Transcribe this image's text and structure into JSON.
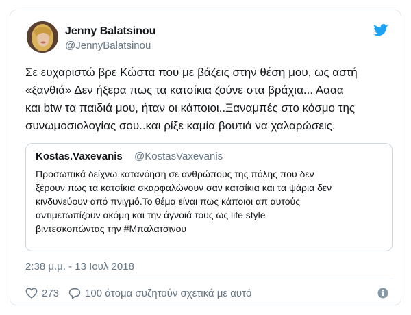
{
  "author": {
    "name": "Jenny Balatsinou",
    "handle": "@JennyBalatsinou",
    "avatar_icon": "profile-photo"
  },
  "tweet": {
    "lines": [
      "Σε ευχαριστώ βρε Κώστα που με βάζεις στην θέση μου, ως αστή",
      "«ξανθιά» Δεν ήξερα πως τα κατσίκια ζούνε στα βράχια... Αααα",
      "και btw τα παιδιά μου, ήταν οι κάποιοι..Ξαναμπές  στο κόσμο της",
      "συνωμοσιολογίας σου..και ρίξε καμία βουτιά να χαλαρώσεις."
    ]
  },
  "quoted": {
    "name": "Kostas.Vaxevanis",
    "handle": "@KostasVaxevanis",
    "lines": [
      "Προσωπικά δείχνω κατανόηση σε ανθρώπους της πόλης που δεν",
      "ξέρουν πως τα κατσίκια σκαρφαλώνουν σαν κατσίκια και τα ψάρια δεν",
      "κινδυνεύουν από πνιγμό.Το θέμα είναι πως κάποιοι απ αυτούς",
      "αντιμετωπίζουν ακόμη και την άγνοιά τους ως life style",
      "βιντεσκοπώντας την #Μπαλατσινου"
    ]
  },
  "timestamp": "2:38 μ.μ. - 13 Ιουλ 2018",
  "actions": {
    "likes": "273",
    "replies": "100 άτομα συζητούν σχετικά με αυτό"
  },
  "colors": {
    "twitter_blue": "#1da1f2",
    "secondary_text": "#657786",
    "border": "#e1e8ed"
  },
  "icons": [
    "twitter-bird-icon",
    "heart-icon",
    "reply-bubble-icon",
    "info-icon"
  ]
}
